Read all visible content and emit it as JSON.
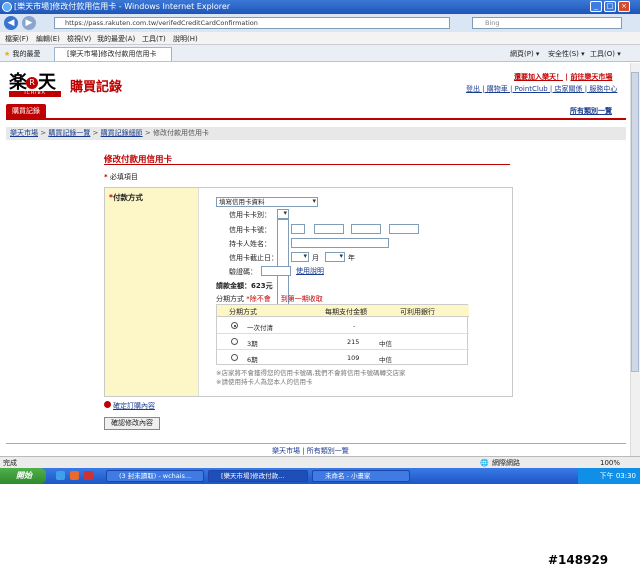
{
  "window": {
    "title": "[樂天市場]修改付款用信用卡 - Windows Internet Explorer",
    "controls": [
      "_",
      "□",
      "×"
    ]
  },
  "address": {
    "url": "https://pass.rakuten.com.tw/verifedCreditCardConfirmation",
    "search_placeholder": "Bing"
  },
  "menus": [
    "檔案(F)",
    "編輯(E)",
    "檢視(V)",
    "我的最愛(A)",
    "工具(T)",
    "說明(H)"
  ],
  "tabbar": {
    "favorites": "我的最愛",
    "tab_title": "[樂天市場]修改付款用信用卡",
    "tools": [
      "網頁(P) ▾",
      "安全性(S) ▾",
      "工具(O) ▾"
    ]
  },
  "header": {
    "logo_char": "楽",
    "logo_r": "R",
    "logo_char2": "天",
    "logo_sub": "ICHIBA",
    "page_title": "購買記錄",
    "join_text": "還要加入樂天！",
    "go_text": "前往樂天市場",
    "links": "登出 | 購物車 | PointClub | 店家關係 | 服務中心"
  },
  "nav": {
    "tab": "購買記錄",
    "all_categories": "所有類別一覽"
  },
  "breadcrumb": {
    "home": "樂天市場",
    "list": "購買記錄一覽",
    "detail": "購買記錄細節",
    "current": "修改付款用信用卡"
  },
  "section": {
    "title": "修改付款用信用卡",
    "required": "必填項目",
    "star": "*"
  },
  "form": {
    "label": "付款方式",
    "select_value": "填寫信用卡資料",
    "card_type_label": "信用卡卡別：",
    "card_no_label": "信用卡卡號：",
    "holder_label": "持卡人姓名：",
    "expiry_label": "信用卡截止日：",
    "month": "月",
    "year": "年",
    "ccv_label": "驗證碼：",
    "ccv_help": "使用說明",
    "amount": "請款金額：623元",
    "pay_label": "分期方式",
    "pay_note": "*除不會",
    "pay_note2": "到第一期收取"
  },
  "installments": {
    "headers": [
      "分期方式",
      "每期支付金額",
      "可利用銀行"
    ],
    "rows": [
      {
        "label": "一次付清",
        "amount": "-",
        "bank": ""
      },
      {
        "label": "3期",
        "amount": "215",
        "bank": "中信"
      },
      {
        "label": "6期",
        "amount": "109",
        "bank": "中信"
      }
    ]
  },
  "notes": [
    "※店家將不會獲得您的信用卡號碼,我們不會將信用卡號碼轉交店家",
    "※請使用持卡人為您本人的信用卡"
  ],
  "actions": {
    "confirm_link": "確定訂購內容",
    "submit": "確認修改內容"
  },
  "footer": {
    "links": "樂天市場 | 所有類別一覽"
  },
  "statusbar": {
    "left": "完成",
    "zone": "網際網路",
    "zoom": "100%"
  },
  "taskbar": {
    "start": "開始",
    "tasks": [
      "(3 封未讀取) - wchais...",
      "[樂天市場]修改付款...",
      "未命名 - 小畫家"
    ],
    "clock": "下午 03:30"
  },
  "watermark": "#148929"
}
